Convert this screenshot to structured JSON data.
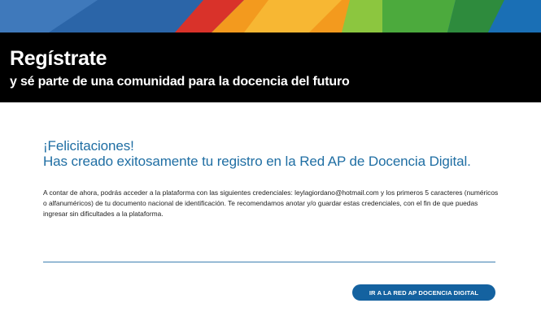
{
  "hero": {
    "title": "Regístrate",
    "subtitle": "y sé parte de una comunidad para la docencia del futuro"
  },
  "message": {
    "line1": "¡Felicitaciones!",
    "line2": "Has creado exitosamente tu registro en la Red AP de Docencia Digital.",
    "body": "A contar de ahora, podrás acceder a la plataforma con las siguientes credenciales: leylagiordano@hotmail.com y los primeros 5 caracteres (numéricos o alfanuméricos) de tu documento nacional de identificación. Te recomendamos anotar y/o guardar estas credenciales, con el fin de que puedas ingresar sin dificultades a la plataforma."
  },
  "cta": {
    "label": "IR A LA RED AP DOCENCIA DIGITAL"
  },
  "colors": {
    "accent_blue": "#1f6ea3",
    "button_blue": "#1462a0",
    "banner_orange": "#f39a1e",
    "banner_red": "#d9322a",
    "banner_green": "#4caa3d",
    "banner_blue": "#1a6fb5",
    "hero_bg": "#000000"
  }
}
